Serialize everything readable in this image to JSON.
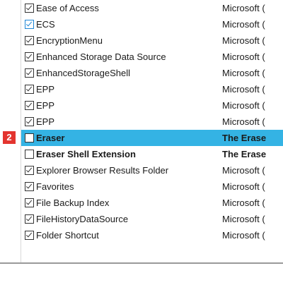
{
  "badge": {
    "number": "2"
  },
  "rows": [
    {
      "name": "Ease of Access",
      "company": "Microsoft (",
      "checked": true,
      "selected": false,
      "bold": false
    },
    {
      "name": "ECS",
      "company": "Microsoft (",
      "checked": true,
      "selected": false,
      "bold": false,
      "accent": "#1e86d6"
    },
    {
      "name": "EncryptionMenu",
      "company": "Microsoft (",
      "checked": true,
      "selected": false,
      "bold": false
    },
    {
      "name": "Enhanced Storage Data Source",
      "company": "Microsoft (",
      "checked": true,
      "selected": false,
      "bold": false
    },
    {
      "name": "EnhancedStorageShell",
      "company": "Microsoft (",
      "checked": true,
      "selected": false,
      "bold": false
    },
    {
      "name": "EPP",
      "company": "Microsoft (",
      "checked": true,
      "selected": false,
      "bold": false
    },
    {
      "name": "EPP",
      "company": "Microsoft (",
      "checked": true,
      "selected": false,
      "bold": false
    },
    {
      "name": "EPP",
      "company": "Microsoft (",
      "checked": true,
      "selected": false,
      "bold": false
    },
    {
      "name": "Eraser",
      "company": "The Erase",
      "checked": false,
      "selected": true,
      "bold": true
    },
    {
      "name": "Eraser Shell Extension",
      "company": "The Erase",
      "checked": false,
      "selected": false,
      "bold": true
    },
    {
      "name": "Explorer Browser Results Folder",
      "company": "Microsoft (",
      "checked": true,
      "selected": false,
      "bold": false
    },
    {
      "name": "Favorites",
      "company": "Microsoft (",
      "checked": true,
      "selected": false,
      "bold": false
    },
    {
      "name": "File Backup Index",
      "company": "Microsoft (",
      "checked": true,
      "selected": false,
      "bold": false
    },
    {
      "name": "FileHistoryDataSource",
      "company": "Microsoft (",
      "checked": true,
      "selected": false,
      "bold": false
    },
    {
      "name": "Folder Shortcut",
      "company": "Microsoft (",
      "checked": true,
      "selected": false,
      "bold": false
    }
  ],
  "colors": {
    "selection": "#34b3e4",
    "badge": "#e3342f",
    "checkbox_accent": "#1e86d6"
  }
}
